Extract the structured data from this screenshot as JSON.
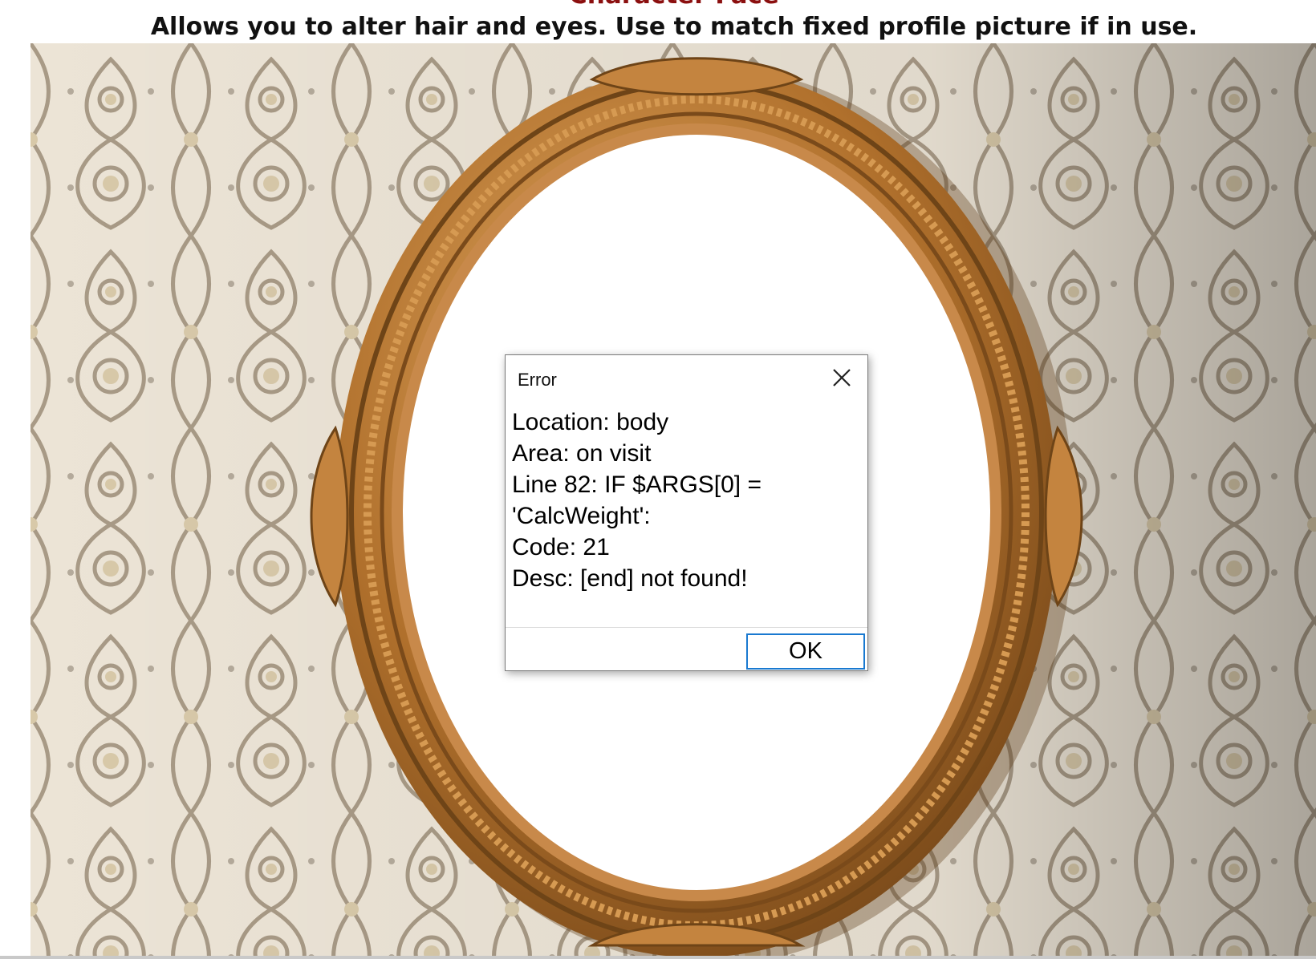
{
  "header": {
    "title": "Character Face",
    "subtitle": "Allows you to alter hair and eyes. Use to match fixed profile picture if in use."
  },
  "scene": {
    "image": "gilded-oval-mirror-on-damask-wallpaper",
    "colors": {
      "wallpaper_light": "#ece4d6",
      "wallpaper_pattern": "#a89a86",
      "frame_gold": "#b0702c",
      "frame_highlight": "#e0a862",
      "mirror_glass": "#ffffff"
    }
  },
  "dialog": {
    "title": "Error",
    "close_icon": "close-icon",
    "lines": [
      "Location: body",
      "Area: on visit",
      "Line 82: IF $ARGS[0] =",
      "'CalcWeight':",
      "Code: 21",
      "Desc: [end] not found!"
    ],
    "ok_label": "OK",
    "accent_color": "#1979d0"
  }
}
